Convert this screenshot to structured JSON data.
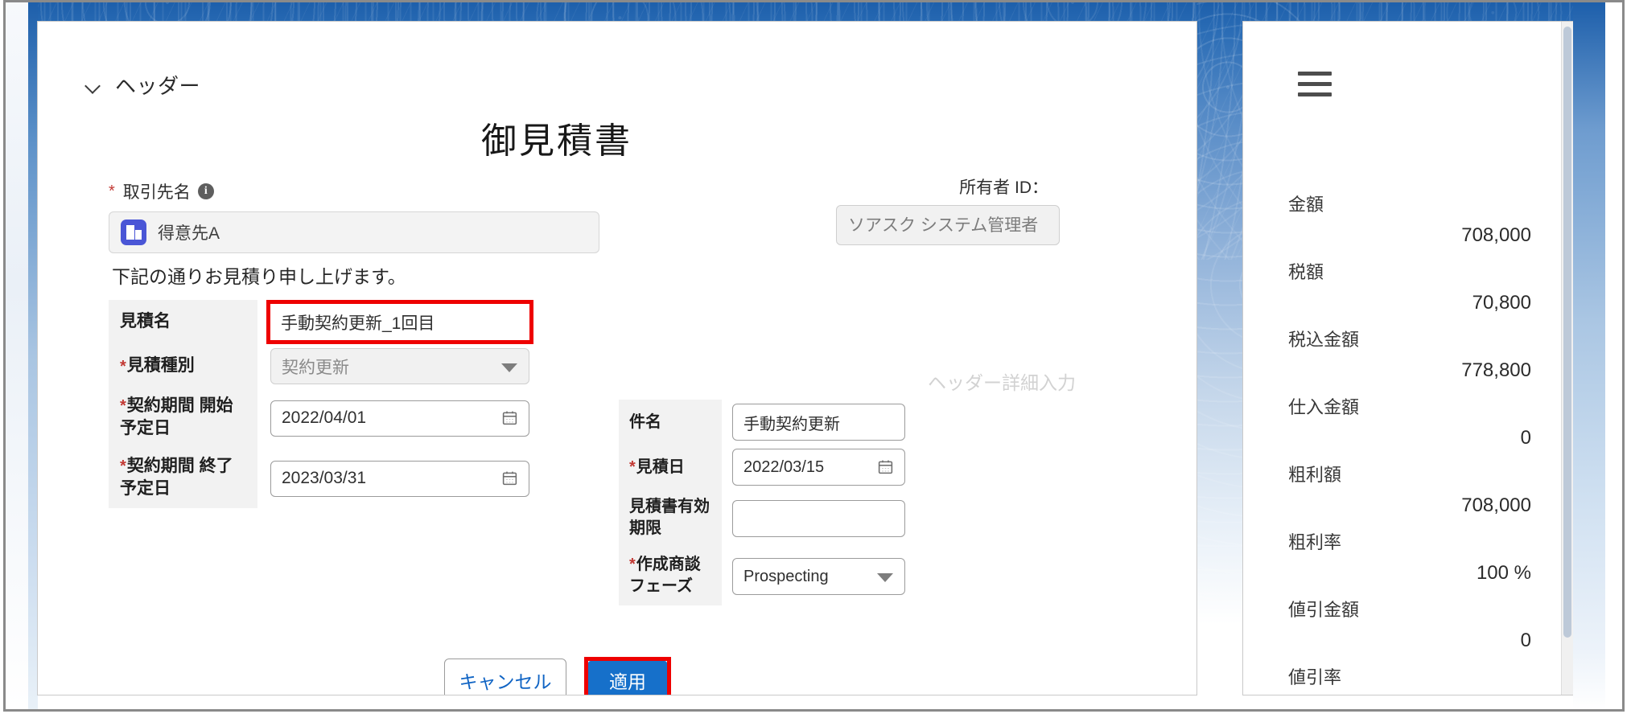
{
  "window": {
    "header_section_label": "ヘッダー",
    "document_title": "御見積書"
  },
  "account": {
    "label": "取引先名",
    "required": "*",
    "info_icon": "info-icon",
    "value": "得意先A",
    "icon": "account-building-icon"
  },
  "owner": {
    "label": "所有者 ID：",
    "value": "ソアスク システム管理者"
  },
  "intro": {
    "text": "下記の通りお見積り申し上げます。"
  },
  "left_fields": [
    {
      "label": "見積名",
      "required": false,
      "value": "手動契約更新_1回目",
      "type": "text",
      "highlighted": true,
      "disabled": false
    },
    {
      "label": "見積種別",
      "required": true,
      "value": "契約更新",
      "type": "select",
      "highlighted": false,
      "disabled": true
    },
    {
      "label": "契約期間 開始予定日",
      "required": true,
      "value": "2022/04/01",
      "type": "date",
      "highlighted": false,
      "disabled": false
    },
    {
      "label": "契約期間 終了予定日",
      "required": true,
      "value": "2023/03/31",
      "type": "date",
      "highlighted": false,
      "disabled": false
    }
  ],
  "header_detail": {
    "title": "ヘッダー詳細入力",
    "fields": [
      {
        "label": "件名",
        "required": false,
        "value": "手動契約更新",
        "type": "text"
      },
      {
        "label": "見積日",
        "required": true,
        "value": "2022/03/15",
        "type": "date"
      },
      {
        "label": "見積書有効期限",
        "required": false,
        "value": "",
        "type": "text"
      },
      {
        "label": "作成商談フェーズ",
        "required": true,
        "value": "Prospecting",
        "type": "select"
      }
    ]
  },
  "buttons": {
    "cancel": "キャンセル",
    "apply": "適用"
  },
  "sidebar": {
    "menu_icon": "hamburger-menu-icon",
    "totals": [
      {
        "label": "金額",
        "value": "708,000"
      },
      {
        "label": "税額",
        "value": "70,800"
      },
      {
        "label": "税込金額",
        "value": "778,800"
      },
      {
        "label": "仕入金額",
        "value": "0"
      },
      {
        "label": "粗利額",
        "value": "708,000"
      },
      {
        "label": "粗利率",
        "value": "100 %"
      },
      {
        "label": "値引金額",
        "value": "0"
      },
      {
        "label": "値引率",
        "value": ""
      }
    ]
  },
  "colors": {
    "required_star": "#c23934",
    "highlight": "#ee0000",
    "primary_button": "#1670ca",
    "link_text": "#1064c4",
    "account_icon": "#4a56d6"
  }
}
